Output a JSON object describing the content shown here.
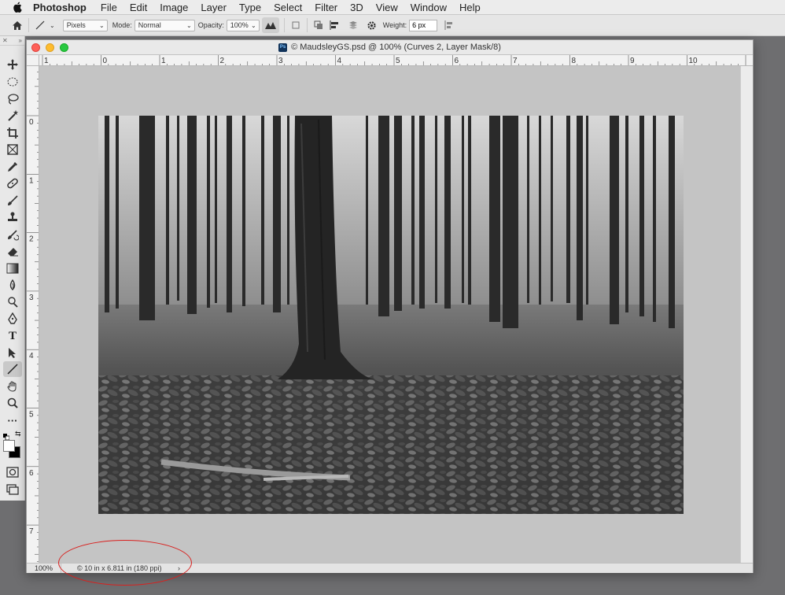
{
  "menubar": {
    "app_name": "Photoshop",
    "items": [
      "File",
      "Edit",
      "Image",
      "Layer",
      "Type",
      "Select",
      "Filter",
      "3D",
      "View",
      "Window",
      "Help"
    ]
  },
  "options": {
    "units": "Pixels",
    "mode_label": "Mode:",
    "mode": "Normal",
    "opacity_label": "Opacity:",
    "opacity": "100%",
    "weight_label": "Weight:",
    "weight": "6 px"
  },
  "document": {
    "title": "© MaudsleyGS.psd @ 100% (Curves 2, Layer Mask/8)",
    "zoom": "100%",
    "doc_info": "© 10 in x 6.811 in (180 ppi)",
    "status_arrow": "›"
  },
  "rulers": {
    "h_labels": [
      "1",
      "0",
      "1",
      "2",
      "3",
      "4",
      "5",
      "6",
      "7",
      "8",
      "9",
      "10"
    ],
    "v_labels": [
      "0",
      "1",
      "2",
      "3",
      "4",
      "5",
      "6",
      "7"
    ]
  },
  "colors": {
    "annotation": "#d9201e",
    "close": "#fe5f57",
    "minimize": "#febc2e",
    "zoom": "#28c840"
  },
  "icons": {
    "tools": [
      "move-icon",
      "marquee-icon",
      "lasso-icon",
      "magic-wand-icon",
      "crop-icon",
      "frame-icon",
      "eyedropper-icon",
      "healing-icon",
      "brush-icon",
      "stamp-icon",
      "history-brush-icon",
      "eraser-icon",
      "gradient-icon",
      "blur-icon",
      "dodge-icon",
      "pen-icon",
      "type-icon",
      "path-select-icon",
      "line-icon",
      "hand-icon",
      "zoom-icon",
      "more-icon"
    ]
  }
}
